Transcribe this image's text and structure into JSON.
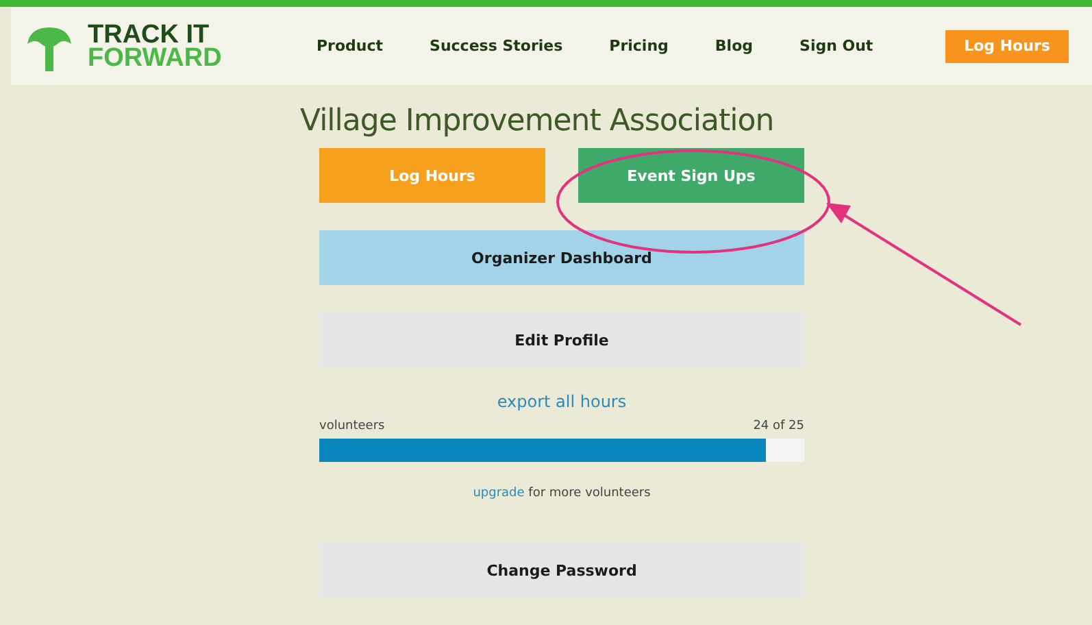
{
  "logo": {
    "line_1": "TRACK IT",
    "line_2": "FORWARD"
  },
  "nav": {
    "links": [
      "Product",
      "Success Stories",
      "Pricing",
      "Blog",
      "Sign Out"
    ],
    "button": "Log Hours"
  },
  "title": "Village Improvement Association",
  "actions": [
    {
      "label": "Log Hours",
      "kind": "orange"
    },
    {
      "label": "Event Sign Ups",
      "kind": "green"
    }
  ],
  "buttons": [
    {
      "label": "Organizer Dashboard",
      "kind": "blue"
    },
    {
      "label": "Edit Profile",
      "kind": "grey"
    }
  ],
  "export_link": "export all hours",
  "usage": {
    "label": "volunteers",
    "reading": "24 of 25",
    "level": 0.92
  },
  "upgrade": {
    "link": "upgrade",
    "text": " for more volunteers"
  },
  "bottom_button": "Change Password"
}
